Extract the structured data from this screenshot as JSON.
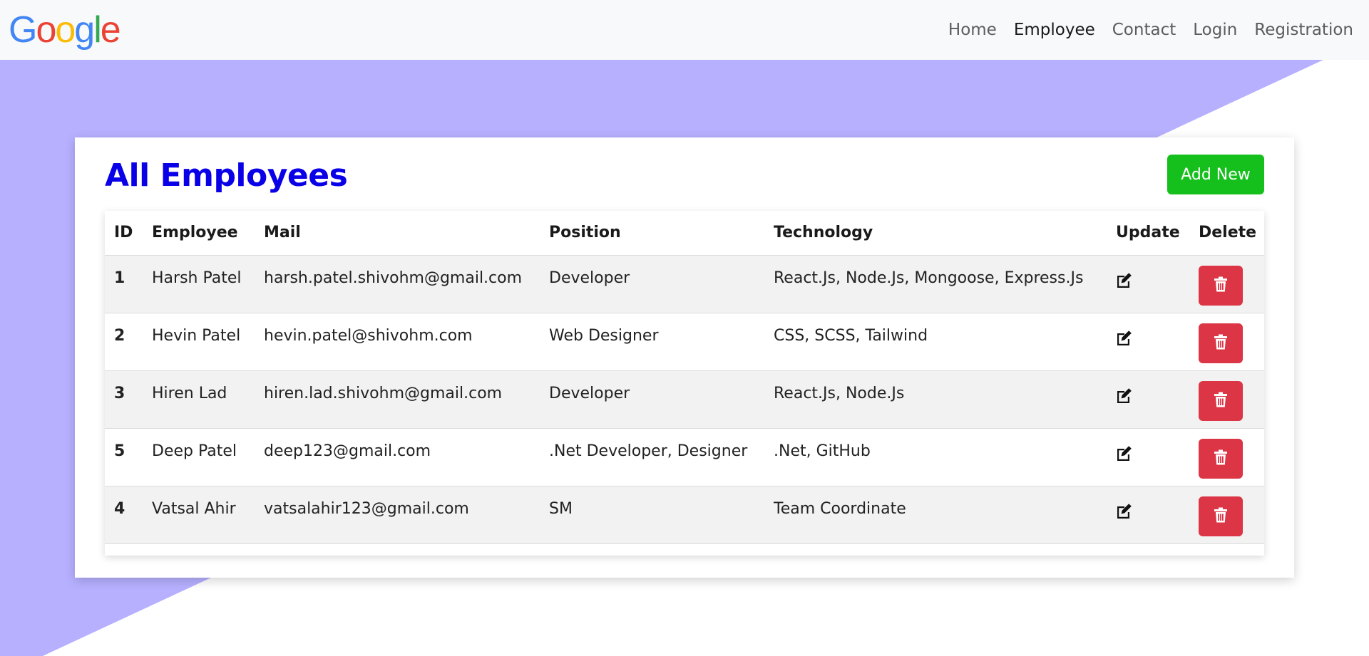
{
  "brand": {
    "letters": [
      "G",
      "o",
      "o",
      "g",
      "l",
      "e"
    ],
    "colors": [
      "#4285F4",
      "#EA4335",
      "#FBBC05",
      "#4285F4",
      "#34A853",
      "#EA4335"
    ]
  },
  "nav": {
    "items": [
      {
        "label": "Home",
        "active": false
      },
      {
        "label": "Employee",
        "active": true
      },
      {
        "label": "Contact",
        "active": false
      },
      {
        "label": "Login",
        "active": false
      },
      {
        "label": "Registration",
        "active": false
      }
    ]
  },
  "main": {
    "title": "All Employees",
    "add_button": "Add New"
  },
  "table": {
    "headers": [
      "ID",
      "Employee",
      "Mail",
      "Position",
      "Technology",
      "Update",
      "Delete"
    ],
    "rows": [
      {
        "id": "1",
        "employee": "Harsh Patel",
        "mail": "harsh.patel.shivohm@gmail.com",
        "position": "Developer",
        "technology": "React.Js, Node.Js, Mongoose, Express.Js"
      },
      {
        "id": "2",
        "employee": "Hevin Patel",
        "mail": "hevin.patel@shivohm.com",
        "position": "Web Designer",
        "technology": "CSS, SCSS, Tailwind"
      },
      {
        "id": "3",
        "employee": "Hiren Lad",
        "mail": "hiren.lad.shivohm@gmail.com",
        "position": "Developer",
        "technology": "React.Js, Node.Js"
      },
      {
        "id": "5",
        "employee": "Deep Patel",
        "mail": "deep123@gmail.com",
        "position": ".Net Developer, Designer",
        "technology": ".Net, GitHub"
      },
      {
        "id": "4",
        "employee": "Vatsal Ahir",
        "mail": "vatsalahir123@gmail.com",
        "position": "SM",
        "technology": "Team Coordinate"
      }
    ]
  },
  "icons": {
    "update": "edit-icon",
    "delete": "trash-icon"
  },
  "colors": {
    "background_accent": "#b6b0ff",
    "title": "#0a00e8",
    "add_button": "#16c01c",
    "delete_button": "#dc3545"
  }
}
